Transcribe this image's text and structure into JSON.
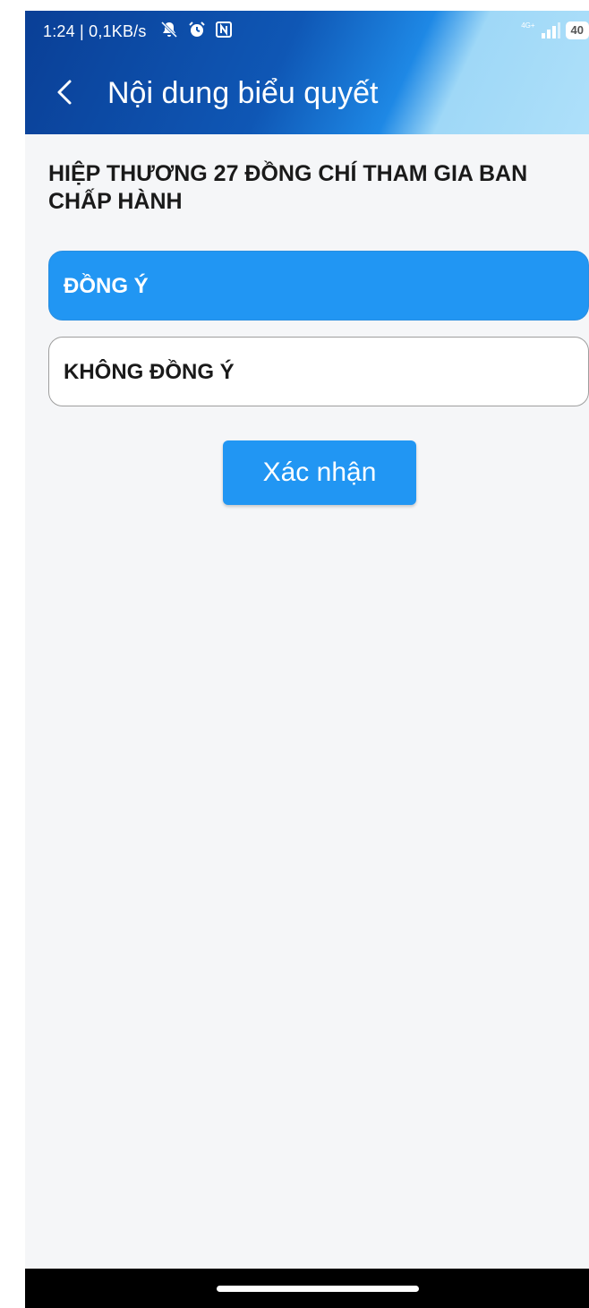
{
  "status_bar": {
    "time": "1:24 | 0,1KB/s",
    "network_label": "4G+",
    "battery": "40",
    "icons": [
      "mute-icon",
      "alarm-icon",
      "nfc-icon",
      "signal-icon",
      "battery-icon"
    ]
  },
  "header": {
    "title": "Nội dung biểu quyết",
    "back_icon": "chevron-left-icon"
  },
  "vote": {
    "question": "HIỆP THƯƠNG 27 ĐỒNG CHÍ THAM GIA BAN CHẤP HÀNH",
    "options": [
      {
        "label": "ĐỒNG Ý",
        "selected": true
      },
      {
        "label": "KHÔNG ĐỒNG Ý",
        "selected": false
      }
    ],
    "confirm_label": "Xác nhận"
  },
  "colors": {
    "accent": "#2196f3",
    "header_dark": "#0a3f96",
    "header_light": "#aee0fa",
    "background": "#f5f6f8"
  }
}
